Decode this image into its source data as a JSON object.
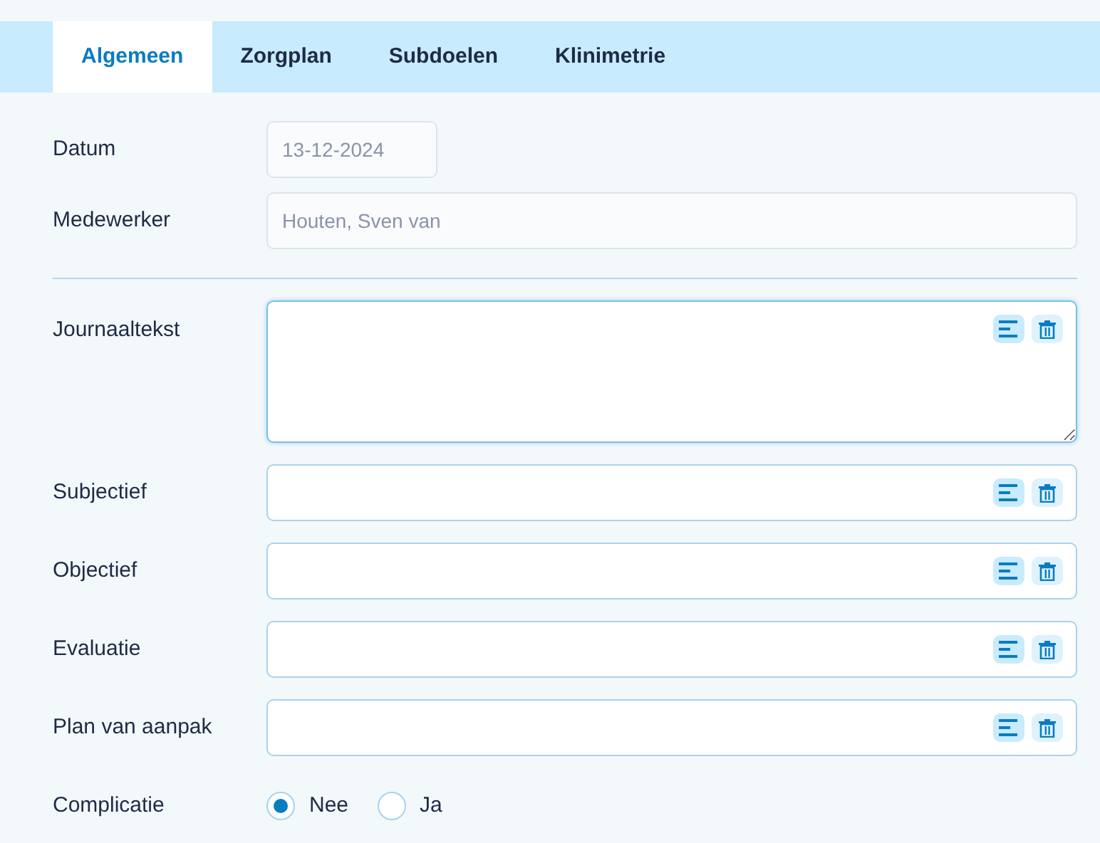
{
  "tabs": [
    {
      "label": "Algemeen",
      "selected": true
    },
    {
      "label": "Zorgplan",
      "selected": false
    },
    {
      "label": "Subdoelen",
      "selected": false
    },
    {
      "label": "Klinimetrie",
      "selected": false
    }
  ],
  "header_fields": [
    {
      "label": "Datum",
      "value": "13-12-2024",
      "kind": "date",
      "disabled": true
    },
    {
      "label": "Medewerker",
      "value": "Houten, Sven van",
      "kind": "text",
      "disabled": true
    }
  ],
  "text_fields": [
    {
      "label": "Journaaltekst",
      "kind": "textarea",
      "focused": true
    },
    {
      "label": "Subjectief",
      "kind": "text",
      "focused": false
    },
    {
      "label": "Objectief",
      "kind": "text",
      "focused": false
    },
    {
      "label": "Evaluatie",
      "kind": "text",
      "focused": false
    },
    {
      "label": "Plan van aanpak",
      "kind": "text",
      "focused": false
    }
  ],
  "complicatie": {
    "label": "Complicatie",
    "options": [
      {
        "label": "Nee",
        "selected": true
      },
      {
        "label": "Ja",
        "selected": false
      }
    ]
  }
}
